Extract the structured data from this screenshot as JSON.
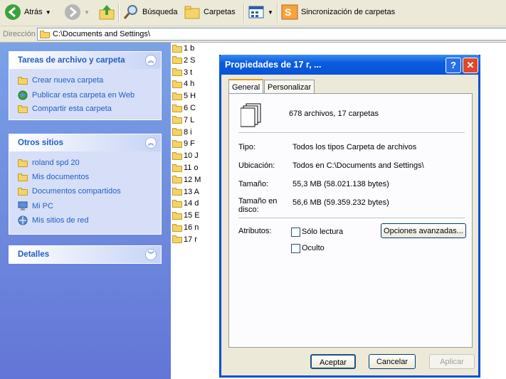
{
  "toolbar": {
    "back_label": "Atrás",
    "search_label": "Búsqueda",
    "folders_label": "Carpetas",
    "sync_label": "Sincronización de carpetas"
  },
  "address": {
    "label": "Dirección",
    "path": "C:\\Documents and Settings\\"
  },
  "taskpane": {
    "file_tasks": {
      "title": "Tareas de archivo y carpeta",
      "items": [
        "Crear nueva carpeta",
        "Publicar esta carpeta en Web",
        "Compartir esta carpeta"
      ]
    },
    "other_places": {
      "title": "Otros sitios",
      "items": [
        "roland spd 20",
        "Mis documentos",
        "Documentos compartidos",
        "Mi PC",
        "Mis sitios de red"
      ]
    },
    "details": {
      "title": "Detalles"
    }
  },
  "files": [
    "1 b",
    "2 S",
    "3 t",
    "4 h",
    "5 H",
    "6 C",
    "7 L",
    "8 i",
    "9 F",
    "10 J",
    "11 o",
    "12 M",
    "13 A",
    "14 d",
    "15 E",
    "16 n",
    "17 r"
  ],
  "dialog": {
    "title": "Propiedades de 17 r, ...",
    "tabs": [
      "General",
      "Personalizar"
    ],
    "summary": "678 archivos, 17 carpetas",
    "type_label": "Tipo:",
    "type_value": "Todos los tipos Carpeta de archivos",
    "location_label": "Ubicación:",
    "location_value": "Todos en C:\\Documents and Settings\\",
    "size_label": "Tamaño:",
    "size_value": "55,3 MB (58.021.138 bytes)",
    "disk_size_label_1": "Tamaño en",
    "disk_size_label_2": "disco:",
    "disk_size_value": "56,6 MB (59.359.232 bytes)",
    "attributes_label": "Atributos:",
    "readonly_label": "Sólo lectura",
    "hidden_label": "Oculto",
    "advanced_button": "Opciones avanzadas...",
    "ok_button": "Aceptar",
    "cancel_button": "Cancelar",
    "apply_button": "Aplicar"
  }
}
